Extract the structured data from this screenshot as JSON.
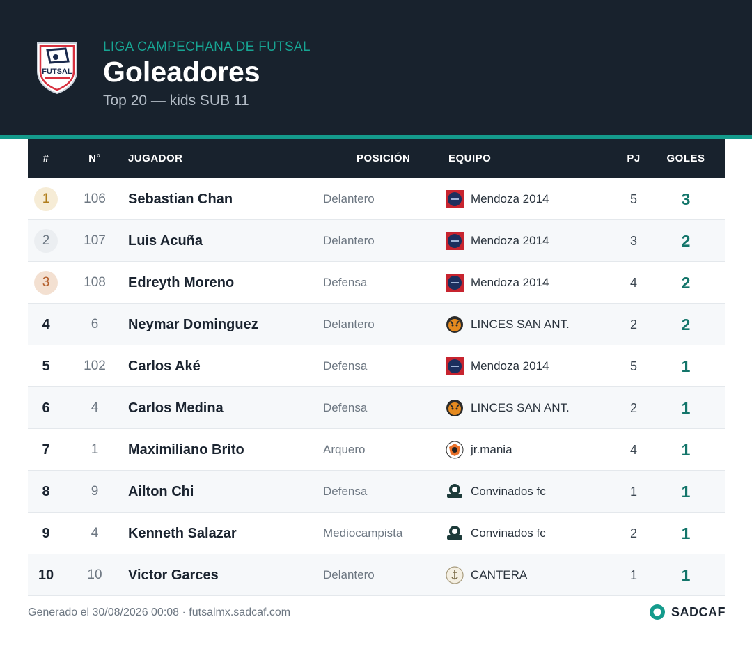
{
  "header": {
    "league": "LIGA CAMPECHANA DE FUTSAL",
    "title": "Goleadores",
    "subtitle": "Top 20 — kids SUB 11",
    "logo_text": "FUTSAL"
  },
  "columns": {
    "rank": "#",
    "number": "N°",
    "player": "JUGADOR",
    "position": "POSICIÓN",
    "team": "EQUIPO",
    "pj": "PJ",
    "goals": "GOLES"
  },
  "rows": [
    {
      "rank": "1",
      "number": "106",
      "player": "Sebastian Chan",
      "position": "Delantero",
      "team": "Mendoza 2014",
      "team_icon": "mendoza-logo",
      "pj": "5",
      "goals": "3"
    },
    {
      "rank": "2",
      "number": "107",
      "player": "Luis Acuña",
      "position": "Delantero",
      "team": "Mendoza 2014",
      "team_icon": "mendoza-logo",
      "pj": "3",
      "goals": "2"
    },
    {
      "rank": "3",
      "number": "108",
      "player": "Edreyth Moreno",
      "position": "Defensa",
      "team": "Mendoza 2014",
      "team_icon": "mendoza-logo",
      "pj": "4",
      "goals": "2"
    },
    {
      "rank": "4",
      "number": "6",
      "player": "Neymar Dominguez",
      "position": "Delantero",
      "team": "LINCES SAN ANT.",
      "team_icon": "linces-logo",
      "pj": "2",
      "goals": "2"
    },
    {
      "rank": "5",
      "number": "102",
      "player": "Carlos Aké",
      "position": "Defensa",
      "team": "Mendoza 2014",
      "team_icon": "mendoza-logo",
      "pj": "5",
      "goals": "1"
    },
    {
      "rank": "6",
      "number": "4",
      "player": "Carlos Medina",
      "position": "Defensa",
      "team": "LINCES SAN ANT.",
      "team_icon": "linces-logo",
      "pj": "2",
      "goals": "1"
    },
    {
      "rank": "7",
      "number": "1",
      "player": "Maximiliano Brito",
      "position": "Arquero",
      "team": "jr.mania",
      "team_icon": "jrmania-logo",
      "pj": "4",
      "goals": "1"
    },
    {
      "rank": "8",
      "number": "9",
      "player": "Ailton Chi",
      "position": "Defensa",
      "team": "Convinados fc",
      "team_icon": "convinados-logo",
      "pj": "1",
      "goals": "1"
    },
    {
      "rank": "9",
      "number": "4",
      "player": "Kenneth Salazar",
      "position": "Mediocampista",
      "team": "Convinados fc",
      "team_icon": "convinados-logo",
      "pj": "2",
      "goals": "1"
    },
    {
      "rank": "10",
      "number": "10",
      "player": "Victor Garces",
      "position": "Delantero",
      "team": "CANTERA",
      "team_icon": "cantera-logo",
      "pj": "1",
      "goals": "1"
    }
  ],
  "footer": {
    "generated": "Generado el 30/08/2026 00:08 · futsalmx.sadcaf.com",
    "brand": "SADCAF"
  },
  "colors": {
    "header_bg": "#18222d",
    "accent": "#149b8c",
    "goals": "#13756a"
  }
}
